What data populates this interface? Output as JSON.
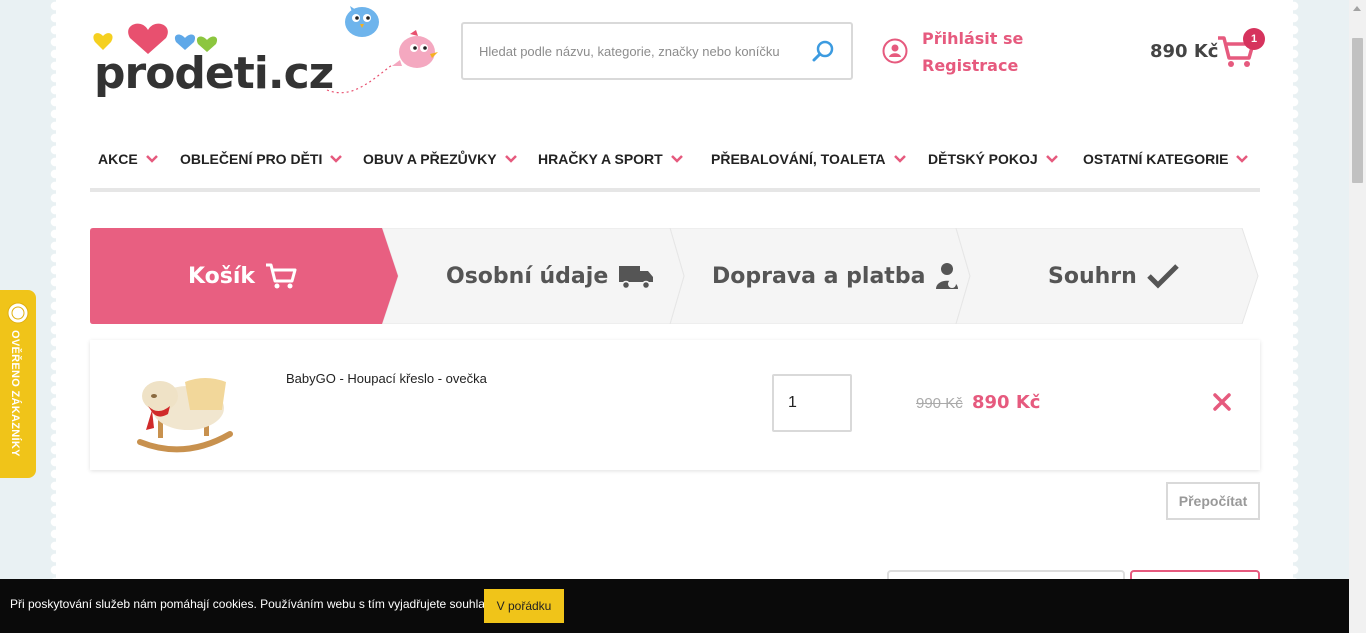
{
  "header": {
    "logo_text": "prodeti.cz",
    "search_placeholder": "Hledat podle názvu, kategorie, značky nebo koníčku",
    "login_label": "Přihlásit se",
    "register_label": "Registrace",
    "cart_total": "890 Kč",
    "cart_count": "1"
  },
  "nav": {
    "items": [
      {
        "label": "AKCE"
      },
      {
        "label": "OBLEČENÍ PRO DĚTI"
      },
      {
        "label": "OBUV A PŘEZŮVKY"
      },
      {
        "label": "HRAČKY A SPORT"
      },
      {
        "label": "PŘEBALOVÁNÍ, TOALETA"
      },
      {
        "label": "DĚTSKÝ POKOJ"
      },
      {
        "label": "OSTATNÍ KATEGORIE"
      }
    ]
  },
  "steps": [
    {
      "label": "Košík",
      "active": true
    },
    {
      "label": "Osobní údaje",
      "active": false
    },
    {
      "label": "Doprava a platba",
      "active": false
    },
    {
      "label": "Souhrn",
      "active": false
    }
  ],
  "cart": {
    "items": [
      {
        "name": "BabyGO - Houpací křeslo - ovečka",
        "quantity": "1",
        "old_price": "990 Kč",
        "price": "890 Kč"
      }
    ],
    "recalc_label": "Přepočítat"
  },
  "badge": {
    "label": "OVĚŘENO ZÁKAZNÍKY"
  },
  "cookie": {
    "text": "Při poskytování služeb nám pomáhají cookies. Používáním webu s tím vyjadřujete souhlas.",
    "button": "V pořádku"
  },
  "colors": {
    "accent": "#e65a7e",
    "badge_yellow": "#f0c419",
    "step_inactive": "#f5f5f5"
  }
}
